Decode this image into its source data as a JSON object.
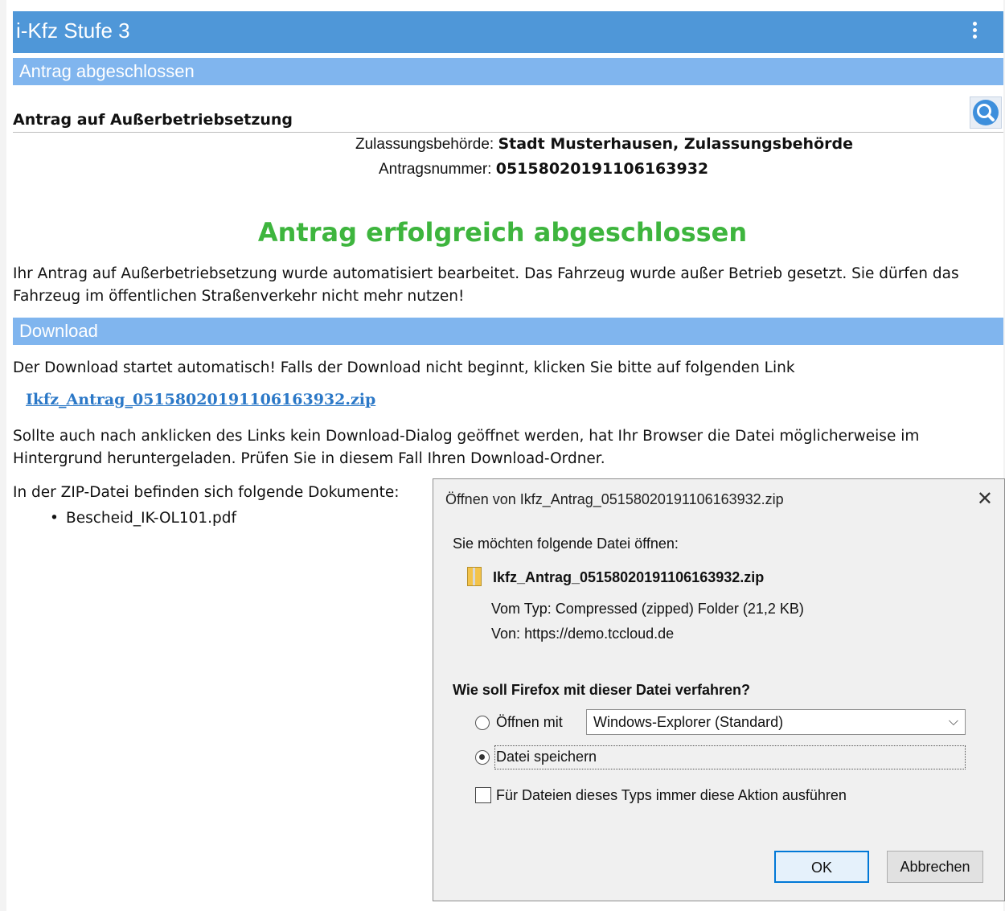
{
  "app": {
    "title": "i-Kfz Stufe 3",
    "section_status": "Antrag abgeschlossen",
    "heading": "Antrag auf Außerbetriebsetzung"
  },
  "info": {
    "authority_label": "Zulassungsbehörde:",
    "authority_value": "Stadt Musterhausen, Zulassungsbehörde",
    "number_label": "Antragsnummer:",
    "number_value": "05158020191106163932"
  },
  "success": {
    "title": "Antrag erfolgreich abgeschlossen",
    "text": "Ihr Antrag auf Außerbetriebsetzung wurde automatisiert bearbeitet. Das Fahrzeug wurde außer Betrieb gesetzt. Sie dürfen das Fahrzeug im öffentlichen Straßenverkehr nicht mehr nutzen!"
  },
  "download": {
    "section_title": "Download",
    "auto_text": "Der Download startet automatisch! Falls der Download nicht beginnt, klicken Sie bitte auf folgenden Link",
    "link_text": "Ikfz_Antrag_05158020191106163932.zip",
    "hint_text": "Sollte auch nach anklicken des Links kein Download-Dialog geöffnet werden, hat Ihr Browser die Datei möglicherweise im Hintergrund heruntergeladen. Prüfen Sie in diesem Fall Ihren Download-Ordner.",
    "zip_contents_label": "In der ZIP-Datei befinden sich folgende Dokumente:",
    "zip_items": [
      "Bescheid_IK-OL101.pdf"
    ]
  },
  "dialog": {
    "title": "Öffnen von Ikfz_Antrag_05158020191106163932.zip",
    "close": "✕",
    "prompt": "Sie möchten folgende Datei öffnen:",
    "filename": "Ikfz_Antrag_05158020191106163932.zip",
    "type_label": "Vom Typ:",
    "type_value": "Compressed (zipped) Folder (21,2 KB)",
    "from_label": "Von:",
    "from_value": "https://demo.tccloud.de",
    "question": "Wie soll Firefox mit dieser Datei verfahren?",
    "open_with_label": "Öffnen mit",
    "open_with_value": "Windows-Explorer (Standard)",
    "save_label": "Datei speichern",
    "always_label": "Für Dateien dieses Typs immer diese Aktion ausführen",
    "ok": "OK",
    "cancel": "Abbrechen"
  }
}
